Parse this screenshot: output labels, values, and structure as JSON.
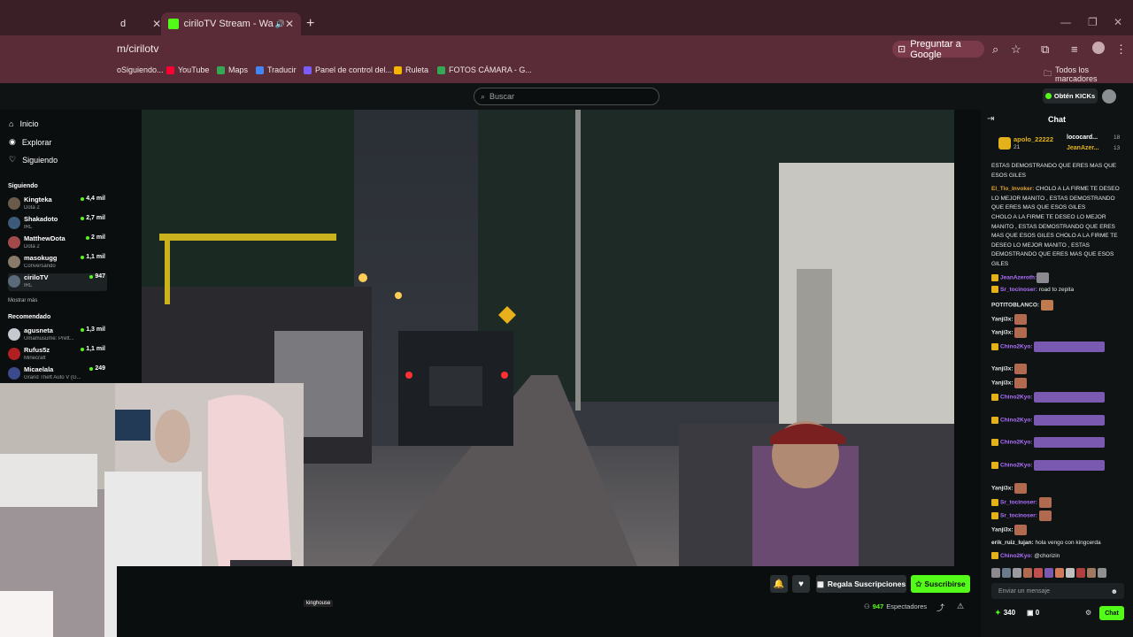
{
  "browser": {
    "tabs": [
      {
        "label": "d",
        "active": false
      },
      {
        "label": "ciriloTV Stream - Watch Live",
        "active": true
      }
    ],
    "url": "m/cirilotv",
    "ask_google": "Preguntar a Google",
    "bookmarks": [
      {
        "label": "oSiguiendo...",
        "color": "#d9b1b8"
      },
      {
        "label": "YouTube",
        "color": "#ff0033"
      },
      {
        "label": "Maps",
        "color": "#34a853"
      },
      {
        "label": "Traducir",
        "color": "#4285f4"
      },
      {
        "label": "Panel de control del...",
        "color": "#7b5cff"
      },
      {
        "label": "Ruleta",
        "color": "#f4b400"
      },
      {
        "label": "FOTOS CÁMARA - G...",
        "color": "#34a853"
      }
    ],
    "all_bookmarks": "Todos los marcadores"
  },
  "header": {
    "search_placeholder": "Buscar",
    "get_kicks": "Obtén KICKs"
  },
  "sidebar": {
    "nav": [
      {
        "label": "Inicio",
        "icon": "home-icon"
      },
      {
        "label": "Explorar",
        "icon": "compass-icon"
      },
      {
        "label": "Siguiendo",
        "icon": "heart-icon"
      }
    ],
    "following_title": "Siguiendo",
    "following": [
      {
        "name": "Kingteka",
        "category": "Dota 2",
        "viewers": "4,4 mil",
        "color": "#6b5b4a"
      },
      {
        "name": "Shakadoto",
        "category": "IRL",
        "viewers": "2,7 mil",
        "color": "#3d5a7a"
      },
      {
        "name": "MatthewDota",
        "category": "Dota 2",
        "viewers": "2 mil",
        "color": "#a04a4a"
      },
      {
        "name": "masokugg",
        "category": "Conversando",
        "viewers": "1,1 mil",
        "color": "#8a7a6a"
      },
      {
        "name": "ciriloTV",
        "category": "IRL",
        "viewers": "947",
        "color": "#5a6a7a"
      }
    ],
    "show_more": "Mostrar más",
    "recommended_title": "Recomendado",
    "recommended": [
      {
        "name": "agusneta",
        "category": "Umamusume: Prett...",
        "viewers": "1,3 mil",
        "color": "#c8c8d0"
      },
      {
        "name": "Rufus5z",
        "category": "Minecraft",
        "viewers": "1,1 mil",
        "color": "#b02020"
      },
      {
        "name": "Micaelala",
        "category": "Grand Theft Auto V (G...",
        "viewers": "249",
        "color": "#3a4a8a"
      }
    ]
  },
  "stream": {
    "overlay_tag": "kinghouse",
    "gift_subs": "Regala Suscripciones",
    "subscribe": "Suscribirse",
    "viewers_count": "947",
    "viewers_label": "Espectadores"
  },
  "chat": {
    "title": "Chat",
    "pinned": [
      {
        "user": "apolo_22222",
        "amount": "21"
      },
      {
        "user": "lococard...",
        "amount": "18"
      },
      {
        "user": "JeanAzer...",
        "amount": "13"
      }
    ],
    "messages": [
      {
        "user": "",
        "text": "ESTAS DEMOSTRANDO QUE ERES MAS QUE ESOS GILES",
        "color": "#ffffff"
      },
      {
        "user": "El_Tio_Invoker:",
        "text": "CHOLO A LA FIRME TE DESEO LO MEJOR MANITO , ESTAS DEMOSTRANDO QUE ERES MAS QUE ESOS GILES",
        "color": "#e0a030"
      },
      {
        "user": "",
        "text": "CHOLO A LA FIRME TE DESEO LO MEJOR MANITO , ESTAS DEMOSTRANDO QUE ERES MAS QUE ESOS GILES CHOLO A LA FIRME TE DESEO LO MEJOR MANITO , ESTAS DEMOSTRANDO QUE ERES MAS QUE ESOS GILES",
        "color": "#ffffff"
      },
      {
        "user": "JeanAzeroth:",
        "text": "",
        "color": "#b070ff"
      },
      {
        "user": "Sr_tocinoser:",
        "text": "road to zepita",
        "color": "#b070ff"
      },
      {
        "user": "POTITOBLANCO:",
        "text": "",
        "color": "#ffffff"
      },
      {
        "user": "Yanji3x:",
        "text": "",
        "color": "#ffffff"
      },
      {
        "user": "Yanji3x:",
        "text": "",
        "color": "#ffffff"
      },
      {
        "user": "Chino2Kyo:",
        "text": "",
        "color": "#b070ff"
      },
      {
        "user": "Yanji3x:",
        "text": "",
        "color": "#ffffff"
      },
      {
        "user": "Yanji3x:",
        "text": "",
        "color": "#ffffff"
      },
      {
        "user": "Chino2Kyo:",
        "text": "",
        "color": "#b070ff"
      },
      {
        "user": "Chino2Kyo:",
        "text": "",
        "color": "#b070ff"
      },
      {
        "user": "Chino2Kyo:",
        "text": "",
        "color": "#b070ff"
      },
      {
        "user": "Chino2Kyo:",
        "text": "",
        "color": "#b070ff"
      },
      {
        "user": "Yanji3x:",
        "text": "",
        "color": "#ffffff"
      },
      {
        "user": "Sr_tocinoser:",
        "text": "",
        "color": "#b070ff"
      },
      {
        "user": "Sr_tocinoser:",
        "text": "",
        "color": "#b070ff"
      },
      {
        "user": "Yanji3x:",
        "text": "",
        "color": "#ffffff"
      },
      {
        "user": "erik_ruiz_lujan:",
        "text": "hola vengo con kingcerda",
        "color": "#ffffff"
      },
      {
        "user": "Chino2Kyo:",
        "text": "@chorizin",
        "color": "#b070ff"
      }
    ],
    "input_placeholder": "Enviar un mensaje",
    "points": "340",
    "gifts": "0",
    "chat_button": "Chat"
  },
  "colors": {
    "accent": "#53fc18",
    "chrome": "#5a2c37",
    "background": "#0b0e0f"
  }
}
